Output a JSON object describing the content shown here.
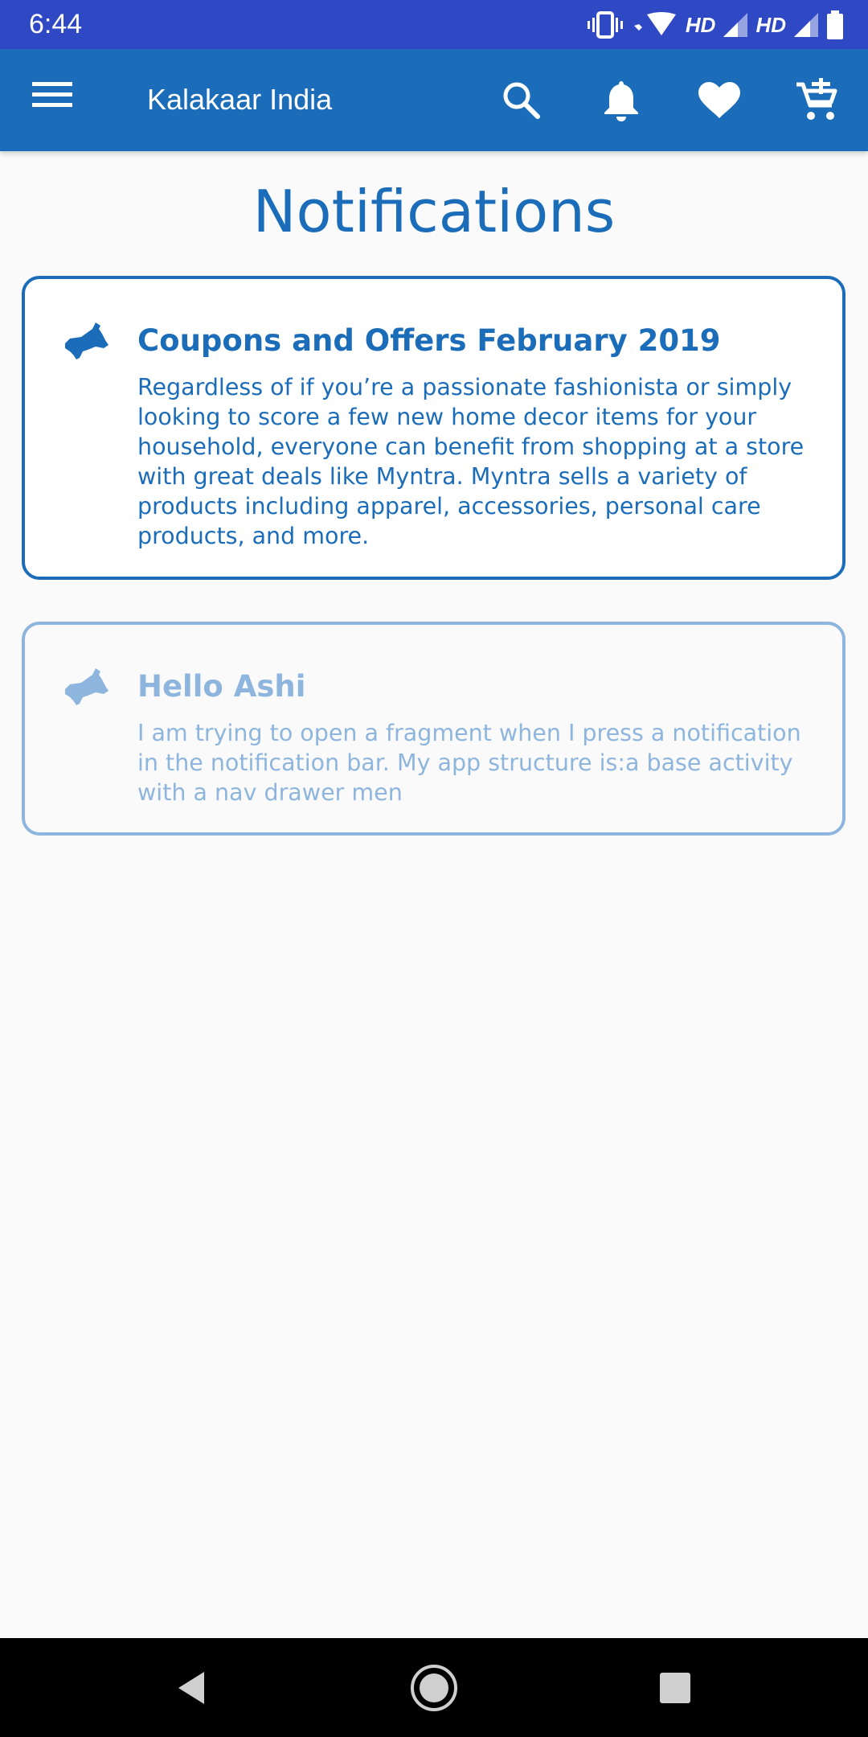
{
  "status_bar": {
    "time": "6:44",
    "network_1": "HD",
    "network_2": "HD",
    "icons": [
      "vibrate-icon",
      "wifi-icon",
      "signal-icon",
      "signal-icon",
      "battery-icon"
    ]
  },
  "app_bar": {
    "title": "Kalakaar India",
    "actions": [
      "search-icon",
      "bell-icon",
      "heart-icon",
      "cart-add-icon"
    ]
  },
  "page": {
    "title": "Notifications"
  },
  "notifications": [
    {
      "title": "Coupons and Offers February 2019",
      "body": "Regardless of if you’re a passionate fashionista or simply looking to score a few new home decor items for your household, everyone can benefit from shopping at a store with great deals like Myntra. Myntra sells a variety of products including apparel, accessories, personal care products, and more.",
      "read": false,
      "icon": "megaphone-icon"
    },
    {
      "title": "Hello Ashi",
      "body": "I am trying to open a fragment when I press a notification in the notification bar. My app structure is:a base activity with a nav drawer men",
      "read": true,
      "icon": "megaphone-icon"
    }
  ],
  "nav_bar": {
    "buttons": [
      "back-icon",
      "home-icon",
      "recents-icon"
    ]
  },
  "colors": {
    "status_bar": "#2f48c4",
    "app_bar": "#1c6db9",
    "accent": "#1c6db9",
    "read_accent": "#8db5dd",
    "background": "#fafafa"
  }
}
